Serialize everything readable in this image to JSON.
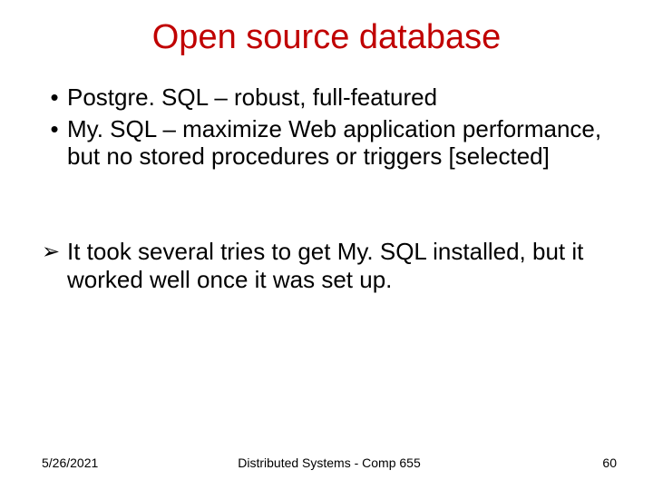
{
  "title": "Open source database",
  "bullets": [
    "Postgre. SQL – robust, full-featured",
    "My. SQL – maximize Web application performance, but no stored procedures or triggers [selected]"
  ],
  "arrow_bullet": "It took several tries to get My. SQL installed, but it worked well once it was set up.",
  "footer": {
    "date": "5/26/2021",
    "center": "Distributed Systems - Comp 655",
    "page": "60"
  },
  "markers": {
    "dot": "•",
    "arrow": "➢"
  }
}
